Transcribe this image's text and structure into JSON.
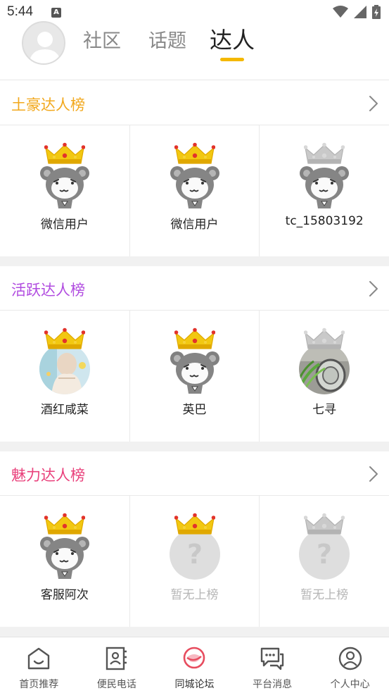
{
  "status_bar": {
    "time": "5:44",
    "notif_badge": "A"
  },
  "header": {
    "tabs": [
      {
        "label": "社区"
      },
      {
        "label": "话题"
      },
      {
        "label": "达人"
      }
    ],
    "active_tab": "达人"
  },
  "sections": [
    {
      "title": "土豪达人榜",
      "title_color": "#f2a81d",
      "users": [
        {
          "name": "微信用户",
          "rank": 1,
          "avatar": "mascot"
        },
        {
          "name": "微信用户",
          "rank": 2,
          "avatar": "mascot"
        },
        {
          "name": "tc_15803192",
          "rank": 3,
          "avatar": "mascot"
        }
      ]
    },
    {
      "title": "活跃达人榜",
      "title_color": "#b14ce0",
      "users": [
        {
          "name": "酒红咸菜",
          "rank": 1,
          "avatar": "photo"
        },
        {
          "name": "英巴",
          "rank": 2,
          "avatar": "mascot"
        },
        {
          "name": "七寻",
          "rank": 3,
          "avatar": "photo-plant"
        }
      ]
    },
    {
      "title": "魅力达人榜",
      "title_color": "#e9407b",
      "users": [
        {
          "name": "客服阿次",
          "rank": 1,
          "avatar": "mascot"
        },
        {
          "name": "暂无上榜",
          "rank": 2,
          "avatar": "empty"
        },
        {
          "name": "暂无上榜",
          "rank": 3,
          "avatar": "empty"
        }
      ]
    }
  ],
  "bottom_nav": [
    {
      "label": "首页推荐",
      "icon": "home-icon"
    },
    {
      "label": "便民电话",
      "icon": "contact-card-icon"
    },
    {
      "label": "同城论坛",
      "icon": "forum-icon",
      "active": true
    },
    {
      "label": "平台消息",
      "icon": "message-icon"
    },
    {
      "label": "个人中心",
      "icon": "user-icon"
    }
  ],
  "colors": {
    "accent": "#f4b800",
    "crown_gold": "#f2c811",
    "crown_gold_dark": "#e0a800",
    "crown_silver": "#c9c9c9",
    "forum_red": "#e74c5e"
  }
}
